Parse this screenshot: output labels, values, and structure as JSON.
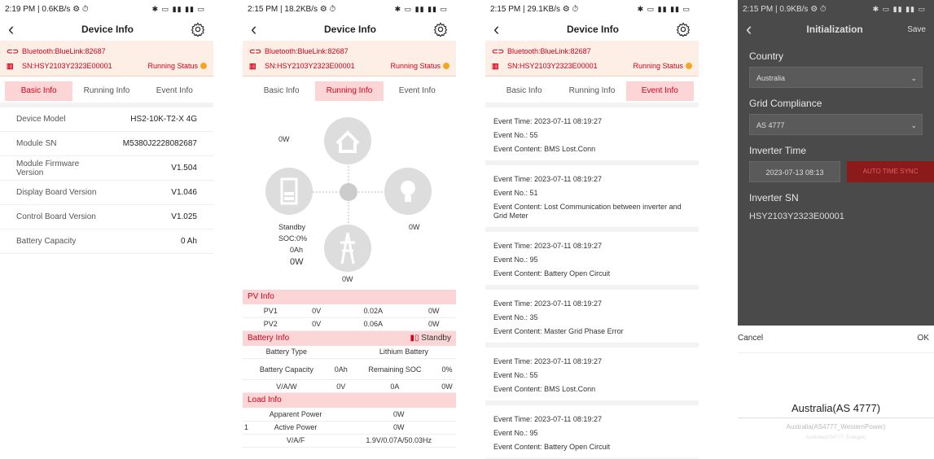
{
  "screen1": {
    "status": "2:19 PM | 0.6KB/s ⚙ ⏱",
    "status_right": "✱ ▭ ▮▮ ▮▮ ▭",
    "title": "Device Info",
    "bluetooth": "Bluetooth:BlueLink:82687",
    "sn": "SN:HSY2103Y2323E00001",
    "running_status": "Running Status",
    "tabs": [
      "Basic Info",
      "Running Info",
      "Event Info"
    ],
    "rows": [
      {
        "k": "Device Model",
        "v": "HS2-10K-T2-X 4G"
      },
      {
        "k": "Module SN",
        "v": "M5380J2228082687"
      },
      {
        "k": "Module Firmware Version",
        "v": "V1.504"
      },
      {
        "k": "Display Board Version",
        "v": "V1.046"
      },
      {
        "k": "Control Board Version",
        "v": "V1.025"
      },
      {
        "k": "Battery Capacity",
        "v": "0 Ah"
      }
    ]
  },
  "screen2": {
    "status": "2:15 PM | 18.2KB/s ⚙ ⏱",
    "title": "Device Info",
    "bluetooth": "Bluetooth:BlueLink:82687",
    "sn": "SN:HSY2103Y2323E00001",
    "running_status": "Running Status",
    "tabs": [
      "Basic Info",
      "Running Info",
      "Event Info"
    ],
    "diagram": {
      "home": "0W",
      "battery_state": "Standby",
      "soc": "SOC:0%",
      "ah": "0Ah",
      "battery_w": "0W",
      "pv": "0W",
      "grid": "0W"
    },
    "pv_info": {
      "title": "PV Info",
      "rows": [
        [
          "PV1",
          "0V",
          "0.02A",
          "0W"
        ],
        [
          "PV2",
          "0V",
          "0.06A",
          "0W"
        ]
      ]
    },
    "battery_info": {
      "title": "Battery Info",
      "state": "Standby",
      "type_label": "Battery Type",
      "type_value": "Lithium Battery",
      "cap_label": "Battery Capacity",
      "cap_value": "0Ah",
      "soc_label": "Remaining SOC",
      "soc_value": "0%",
      "vaw_label": "V/A/W",
      "v": "0V",
      "a": "0A",
      "w": "0W"
    },
    "load_info": {
      "title": "Load Info",
      "idx": "1",
      "apparent_label": "Apparent Power",
      "apparent": "0W",
      "active_label": "Active Power",
      "active": "0W",
      "vaf_label": "V/A/F",
      "vaf": "1.9V/0.07A/50.03Hz"
    }
  },
  "screen3": {
    "status": "2:15 PM | 29.1KB/s ⚙ ⏱",
    "title": "Device Info",
    "bluetooth": "Bluetooth:BlueLink:82687",
    "sn": "SN:HSY2103Y2323E00001",
    "running_status": "Running Status",
    "tabs": [
      "Basic Info",
      "Running Info",
      "Event Info"
    ],
    "labels": {
      "time": "Event Time:",
      "no": "Event No.:",
      "content": "Event Content:"
    },
    "events": [
      {
        "time": "2023-07-11 08:19:27",
        "no": "55",
        "content": "BMS Lost.Conn"
      },
      {
        "time": "2023-07-11 08:19:27",
        "no": "51",
        "content": "Lost Communication between inverter and Grid Meter"
      },
      {
        "time": "2023-07-11 08:19:27",
        "no": "95",
        "content": "Battery Open Circuit"
      },
      {
        "time": "2023-07-11 08:19:27",
        "no": "35",
        "content": "Master Grid Phase Error"
      },
      {
        "time": "2023-07-11 08:19:27",
        "no": "55",
        "content": "BMS Lost.Conn"
      },
      {
        "time": "2023-07-11 08:19:27",
        "no": "95",
        "content": "Battery Open Circuit"
      }
    ]
  },
  "screen4": {
    "status": "2:15 PM | 0.9KB/s ⚙ ⏱",
    "title": "Initialization",
    "save": "Save",
    "country_label": "Country",
    "country": "Australia",
    "grid_label": "Grid Compliance",
    "grid": "AS 4777",
    "time_label": "Inverter Time",
    "time": "2023-07-13 08:13",
    "sync": "AUTO TIME SYNC",
    "sn_label": "Inverter SN",
    "sn": "HSY2103Y2323E00001",
    "cancel": "Cancel",
    "ok": "OK",
    "picker": [
      "Australia(AS 4777)",
      "Australia(AS4777_WesternPower)",
      "Australia(AS4777_Energex)"
    ]
  }
}
